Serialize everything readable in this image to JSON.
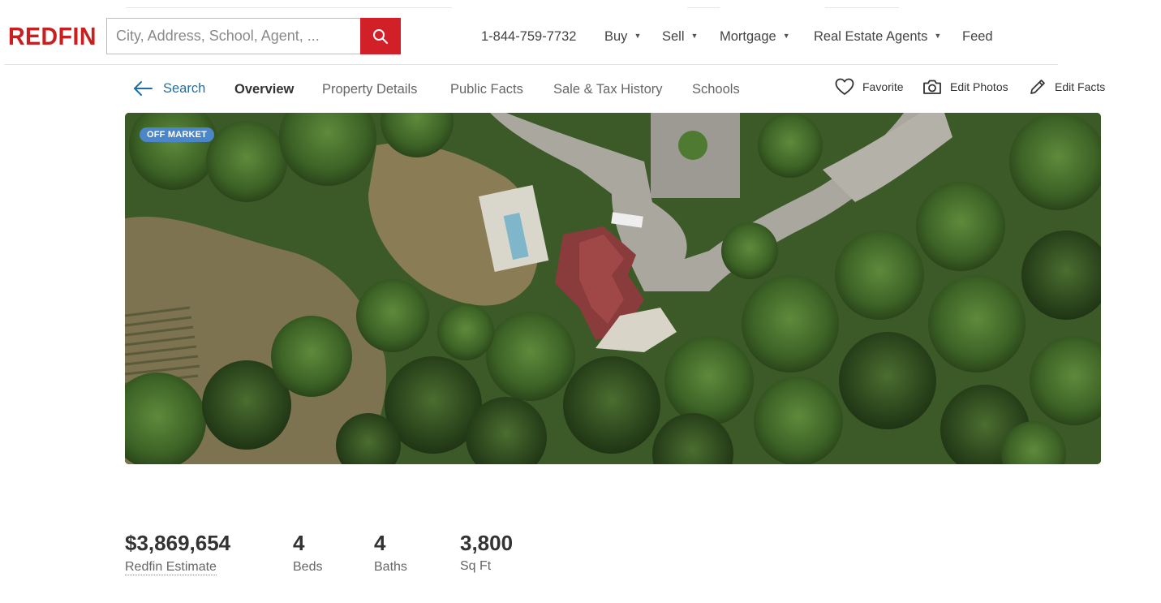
{
  "header": {
    "logo": "REDFIN",
    "search": {
      "placeholder": "City, Address, School, Agent, ..."
    },
    "phone": "1-844-759-7732",
    "nav": [
      {
        "label": "Buy",
        "has_caret": true
      },
      {
        "label": "Sell",
        "has_caret": true
      },
      {
        "label": "Mortgage",
        "has_caret": true
      },
      {
        "label": "Real Estate Agents",
        "has_caret": true
      },
      {
        "label": "Feed",
        "has_caret": false
      }
    ],
    "caret": "▼"
  },
  "subnav": {
    "back_label": "Search",
    "tabs": [
      "Overview",
      "Property Details",
      "Public Facts",
      "Sale & Tax History",
      "Schools"
    ],
    "active_tab": "Overview",
    "actions": {
      "favorite": "Favorite",
      "edit_photos": "Edit Photos",
      "edit_facts": "Edit Facts"
    }
  },
  "photo": {
    "badge": "OFF MARKET"
  },
  "stats": {
    "price": {
      "value": "$3,869,654",
      "label": "Redfin Estimate"
    },
    "beds": {
      "value": "4",
      "label": "Beds"
    },
    "baths": {
      "value": "4",
      "label": "Baths"
    },
    "sqft": {
      "value": "3,800",
      "label": "Sq Ft"
    }
  },
  "colors": {
    "brand_red": "#c82021",
    "search_button": "#d12027",
    "link_blue": "#1e6fa8",
    "badge_blue": "#4a86c8"
  },
  "icons": [
    "search-icon",
    "arrow-left-icon",
    "heart-icon",
    "camera-icon",
    "pencil-icon"
  ]
}
